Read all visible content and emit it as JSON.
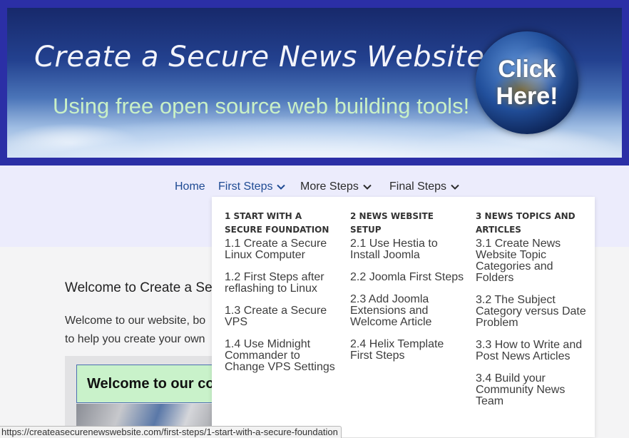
{
  "banner": {
    "title": "Create a Secure News Website…",
    "subtitle": "Using free open source web building tools!",
    "cta": "Click Here!"
  },
  "nav": {
    "items": [
      {
        "label": "Home"
      },
      {
        "label": "First Steps"
      },
      {
        "label": "More Steps"
      },
      {
        "label": "Final Steps"
      }
    ]
  },
  "menu": {
    "columns": [
      {
        "heading": "1 START WITH A SECURE FOUNDATION",
        "links": [
          "1.1 Create a Secure Linux Computer",
          "1.2 First Steps after reflashing to Linux",
          "1.3 Create a Secure VPS",
          "1.4 Use Midnight Commander to Change VPS Settings"
        ]
      },
      {
        "heading": "2 NEWS WEBSITE SETUP",
        "links": [
          "2.1 Use Hestia to Install Joomla",
          "2.2 Joomla First Steps",
          "2.3 Add Joomla Extensions and Welcome Article",
          "2.4 Helix Template First Steps"
        ]
      },
      {
        "heading": "3 NEWS TOPICS AND ARTICLES",
        "links": [
          "3.1 Create News Website Topic Categories and Folders",
          "3.2 The Subject Category versus Date Problem",
          "3.3 How to Write and Post News Articles",
          "3.4 Build your Community News Team"
        ]
      }
    ]
  },
  "content": {
    "title": "Welcome to Create a Se",
    "text_line1": "Welcome to our website, bo",
    "text_line2": "to help you create your own",
    "welcome_box": "Welcome to our co"
  },
  "status_url": "https://createasecurenewswebsite.com/first-steps/1-start-with-a-secure-foundation",
  "colors": {
    "banner_border": "#2b2fa6",
    "nav_active": "#1e4a93",
    "nav_band": "#ececfc",
    "welcome_bg": "#c9f2ca"
  }
}
